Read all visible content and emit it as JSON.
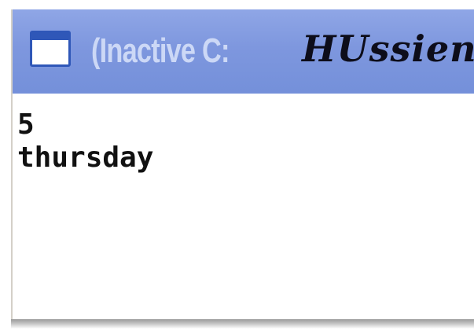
{
  "window": {
    "title_prefix": "(Inactive C:",
    "title_name": "HUssien"
  },
  "console": {
    "lines": [
      "5",
      "thursday"
    ]
  },
  "colors": {
    "titlebar": "#7e97de",
    "title_text": "#ccd8f6",
    "console_background": "#ffffff",
    "console_text": "#111111"
  },
  "icons": {
    "app": "console-window-icon"
  }
}
